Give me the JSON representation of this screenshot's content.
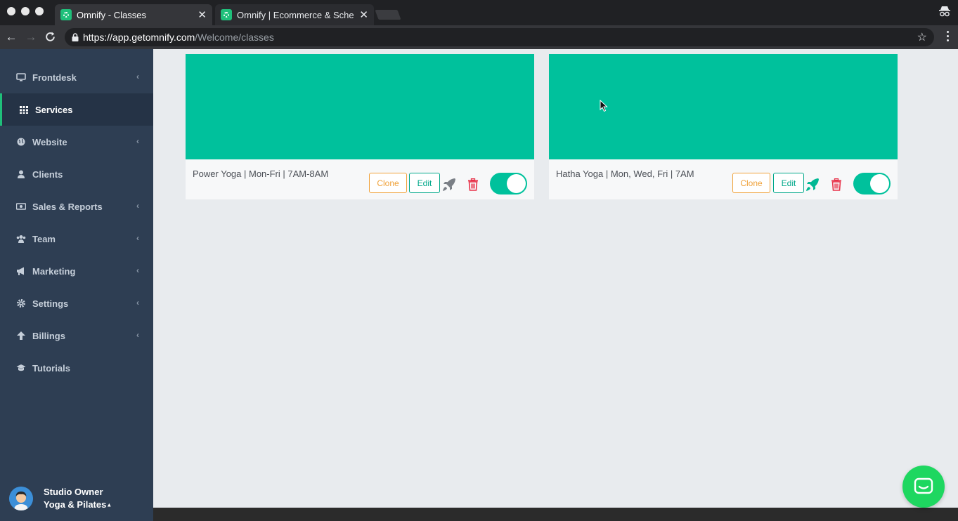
{
  "browser": {
    "tabs": [
      {
        "title": "Omnify - Classes",
        "active": true
      },
      {
        "title": "Omnify | Ecommerce & Schedu",
        "active": false
      }
    ],
    "url": {
      "host": "https://app.getomnify.com",
      "path": "/Welcome/classes"
    }
  },
  "sidebar": {
    "items": [
      {
        "label": "Frontdesk",
        "icon": "monitor-icon",
        "has_submenu": true
      },
      {
        "label": "Services",
        "icon": "grid-icon",
        "has_submenu": false,
        "active": true
      },
      {
        "label": "Website",
        "icon": "globe-icon",
        "has_submenu": true
      },
      {
        "label": "Clients",
        "icon": "user-icon",
        "has_submenu": false
      },
      {
        "label": "Sales & Reports",
        "icon": "money-icon",
        "has_submenu": true
      },
      {
        "label": "Team",
        "icon": "team-icon",
        "has_submenu": true
      },
      {
        "label": "Marketing",
        "icon": "megaphone-icon",
        "has_submenu": true
      },
      {
        "label": "Settings",
        "icon": "gear-icon",
        "has_submenu": true
      },
      {
        "label": "Billings",
        "icon": "arrow-up-icon",
        "has_submenu": true
      },
      {
        "label": "Tutorials",
        "icon": "graduation-cap-icon",
        "has_submenu": false
      }
    ],
    "user": {
      "name": "Studio Owner",
      "studio": "Yoga & Pilates"
    }
  },
  "classes": [
    {
      "title": "Power Yoga | Mon-Fri | 7AM-8AM",
      "clone_label": "Clone",
      "edit_label": "Edit",
      "published": false,
      "enabled": true
    },
    {
      "title": "Hatha Yoga | Mon, Wed, Fri | 7AM",
      "clone_label": "Clone",
      "edit_label": "Edit",
      "published": true,
      "enabled": true
    }
  ],
  "colors": {
    "brand_green": "#00c19c",
    "sidebar_bg": "#2e3e53",
    "clone_orange": "#f0a23a",
    "delete_red": "#e8334a",
    "chat_green": "#1ed760"
  }
}
